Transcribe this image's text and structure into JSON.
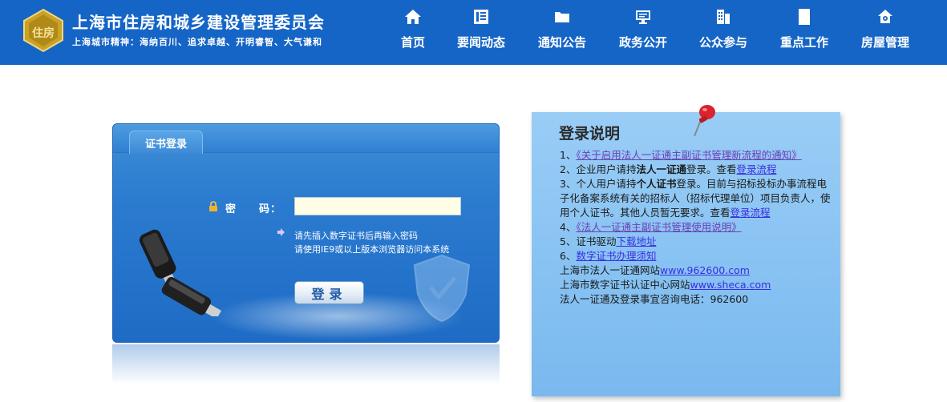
{
  "header": {
    "title": "上海市住房和城乡建设管理委员会",
    "slogan": "上海城市精神：海纳百川、追求卓越、开明睿智、大气谦和",
    "logo_text": "住房"
  },
  "nav": [
    {
      "label": "首页",
      "icon": "home-icon"
    },
    {
      "label": "要闻动态",
      "icon": "news-icon"
    },
    {
      "label": "通知公告",
      "icon": "folder-icon"
    },
    {
      "label": "政务公开",
      "icon": "monitor-icon"
    },
    {
      "label": "公众参与",
      "icon": "building-icon"
    },
    {
      "label": "重点工作",
      "icon": "document-icon"
    },
    {
      "label": "房屋管理",
      "icon": "house-gear-icon"
    }
  ],
  "login": {
    "tab_label": "证书登录",
    "password_label": "密　　码：",
    "password_value": "",
    "hint_line1": "请先插入数字证书后再输入密码",
    "hint_line2": "请使用IE9或以上版本浏览器访问本系统",
    "button_label": "登录"
  },
  "instructions": {
    "title": "登录说明",
    "item1_prefix": "1、",
    "item1_link": "《关于启用法人一证通主副证书管理新流程的通知》",
    "item2_prefix": "2、企业用户请持",
    "item2_bold": "法人一证通",
    "item2_mid": "登录。查看",
    "item2_link": "登录流程",
    "item3_prefix": "3、个人用户请持",
    "item3_bold": "个人证书",
    "item3_mid": "登录。目前与招标投标办事流程电",
    "item3_line2": "子化备案系统有关的招标人（招标代理单位）项目负责人，使",
    "item3_line3": "用个人证书。其他人员暂无要求。查看",
    "item3_link": "登录流程",
    "item4_prefix": "4、",
    "item4_link": "《法人一证通主副证书管理使用说明》",
    "item5_prefix": "5、证书驱动",
    "item5_link": "下载地址",
    "item6_prefix": "6、",
    "item6_link": "数字证书办理须知",
    "site1_prefix": "上海市法人一证通网站",
    "site1_link": "www.962600.com",
    "site2_prefix": "上海市数字证书认证中心网站",
    "site2_link": "www.sheca.com",
    "phone_line": "法人一证通及登录事宜咨询电话：962600"
  }
}
